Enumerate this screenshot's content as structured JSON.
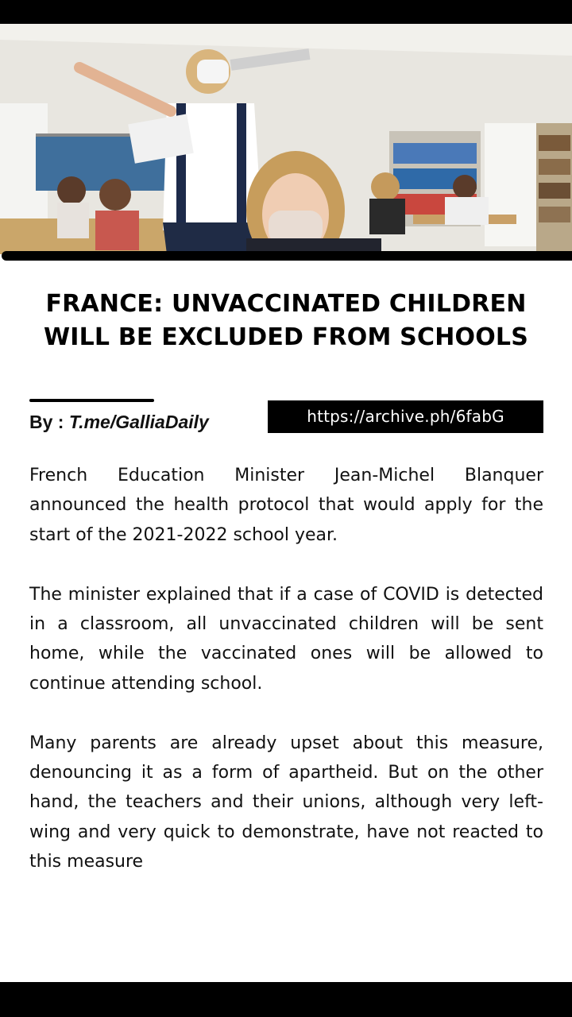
{
  "photo": {
    "description_icon": "classroom-photo"
  },
  "headline": {
    "line1": "FRANCE: UNVACCINATED CHILDREN",
    "line2": "WILL BE EXCLUDED FROM SCHOOLS"
  },
  "byline": {
    "prefix": "By : ",
    "handle": "T.me/GalliaDaily"
  },
  "source_link": "https://archive.ph/6fabG",
  "article": {
    "paragraphs": [
      "French Education Minister Jean-Michel Blanquer announced the health protocol that would apply for the start of the 2021-2022 school year.",
      "The minister explained that if a case of COVID is detected in a classroom, all unvaccinated children will be sent home, while the vaccinated ones will be allowed to continue attending school.",
      "Many parents are already upset about this measure, denouncing it as a form of apartheid. But on the other hand, the teachers and their unions, although very left-wing and very quick to demonstrate, have not reacted to this measure"
    ]
  },
  "colors": {
    "background": "#ffffff",
    "text": "#111111",
    "accent": "#000000"
  }
}
